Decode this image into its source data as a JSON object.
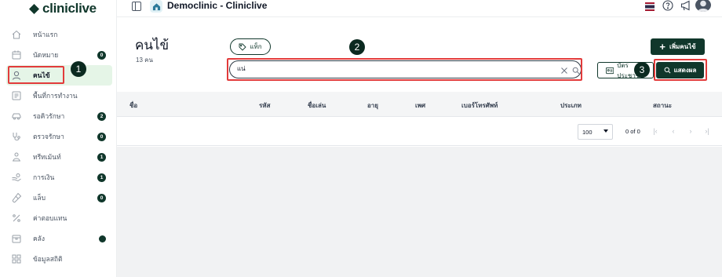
{
  "app": {
    "logo_text": "cliniclive",
    "window_title": "Democlinic - Cliniclive"
  },
  "sidebar": {
    "items": [
      {
        "label": "หน้าแรก",
        "icon": "home-icon",
        "badge": null
      },
      {
        "label": "นัดหมาย",
        "icon": "calendar-icon",
        "badge": "0"
      },
      {
        "label": "คนไข้",
        "icon": "user-icon",
        "badge": null,
        "active": true
      },
      {
        "label": "พื้นที่การทำงาน",
        "icon": "workspace-icon",
        "badge": null
      },
      {
        "label": "รอคิวรักษา",
        "icon": "car-icon",
        "badge": "2"
      },
      {
        "label": "ตรวจรักษา",
        "icon": "stethoscope-icon",
        "badge": "0"
      },
      {
        "label": "ทรีทเม้นท์",
        "icon": "treatment-icon",
        "badge": "1"
      },
      {
        "label": "การเงิน",
        "icon": "payment-icon",
        "badge": "1"
      },
      {
        "label": "แล็บ",
        "icon": "lab-icon",
        "badge": "0"
      },
      {
        "label": "ค่าตอบแทน",
        "icon": "percent-icon",
        "badge": null
      },
      {
        "label": "คลัง",
        "icon": "inventory-icon",
        "dot": true
      },
      {
        "label": "ข้อมูลสถิติ",
        "icon": "stats-icon",
        "badge": null
      }
    ]
  },
  "header": {
    "icons": [
      "panel-toggle-icon",
      "home-icon",
      "thai-flag-icon",
      "help-icon",
      "megaphone-icon",
      "avatar-icon"
    ]
  },
  "page": {
    "title": "คนไข้",
    "count": "13 คน",
    "tag_button": "แท็ก",
    "add_button": "เพิ่มคนไข้",
    "search_value": "แน่",
    "id_card_button": "บัตรประชาชน",
    "show_button": "แสดงผล"
  },
  "steps": [
    "1",
    "2",
    "3"
  ],
  "table": {
    "columns": [
      "ชื่อ",
      "รหัส",
      "ชื่อเล่น",
      "อายุ",
      "เพศ",
      "เบอร์โทรศัพท์",
      "ประเภท",
      "สถานะ"
    ],
    "rows_per_page": "100",
    "range": "0 of 0"
  },
  "colors": {
    "brand": "#10372b",
    "active_bg": "#e5f5e7",
    "highlight": "#e23b3b"
  }
}
